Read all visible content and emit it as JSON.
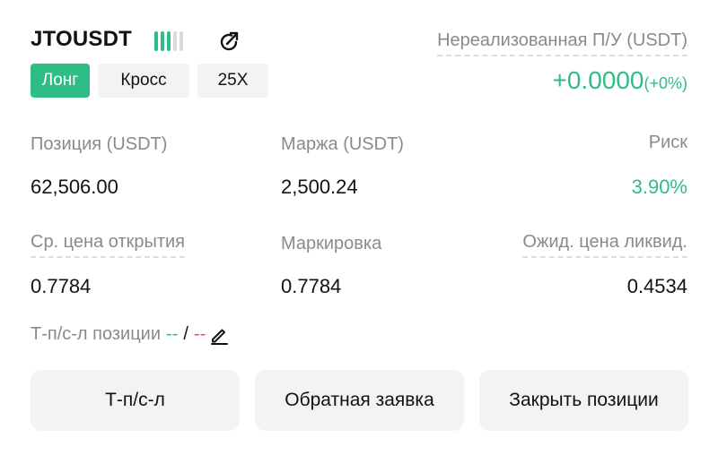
{
  "header": {
    "symbol": "JTOUSDT",
    "signal_bars_active": 3,
    "signal_bars_total": 5,
    "share_icon": "share-refresh-icon",
    "unrealized_label": "Нереализованная П/У (USDT)",
    "unrealized_value": "+0.0000",
    "unrealized_percent": "(+0%)"
  },
  "tags": {
    "side": "Лонг",
    "margin_mode": "Кросс",
    "leverage": "25X"
  },
  "stats": {
    "position_label": "Позиция (USDT)",
    "position_value": "62,506.00",
    "margin_label": "Маржа (USDT)",
    "margin_value": "2,500.24",
    "risk_label": "Риск",
    "risk_value": "3.90%",
    "avg_open_label": "Ср. цена открытия",
    "avg_open_value": "0.7784",
    "mark_label": "Маркировка",
    "mark_value": "0.7784",
    "liq_label": "Ожид. цена ликвид.",
    "liq_value": "0.4534"
  },
  "tpsl": {
    "label": "Т-п/с-л позиции",
    "tp_value": "--",
    "separator": "/",
    "sl_value": "--",
    "edit_icon": "pencil-icon"
  },
  "actions": {
    "tpsl_button": "Т-п/с-л",
    "reverse_button": "Обратная заявка",
    "close_button": "Закрыть позиции"
  },
  "colors": {
    "accent_green": "#2ebd85",
    "accent_red": "#f6465d",
    "muted_text": "#8a8a8a",
    "button_bg": "#f3f3f3"
  }
}
